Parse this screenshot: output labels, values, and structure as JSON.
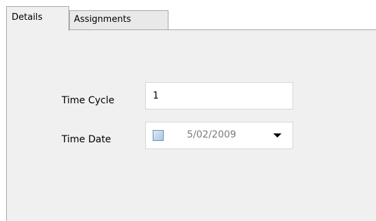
{
  "tabs": [
    {
      "label": "Details",
      "active": true
    },
    {
      "label": "Assignments",
      "active": false
    }
  ],
  "form": {
    "time_cycle": {
      "label": "Time Cycle",
      "value": "1"
    },
    "time_date": {
      "label": "Time Date",
      "value": "5/02/2009",
      "checked": false
    }
  },
  "icons": {
    "date_checkbox": "checkbox-icon",
    "dropdown": "chevron-down-icon"
  },
  "colors": {
    "panel_bg": "#f0f0f0",
    "tab_border": "#a7a7a7",
    "disabled_text": "#7a7a7a"
  }
}
